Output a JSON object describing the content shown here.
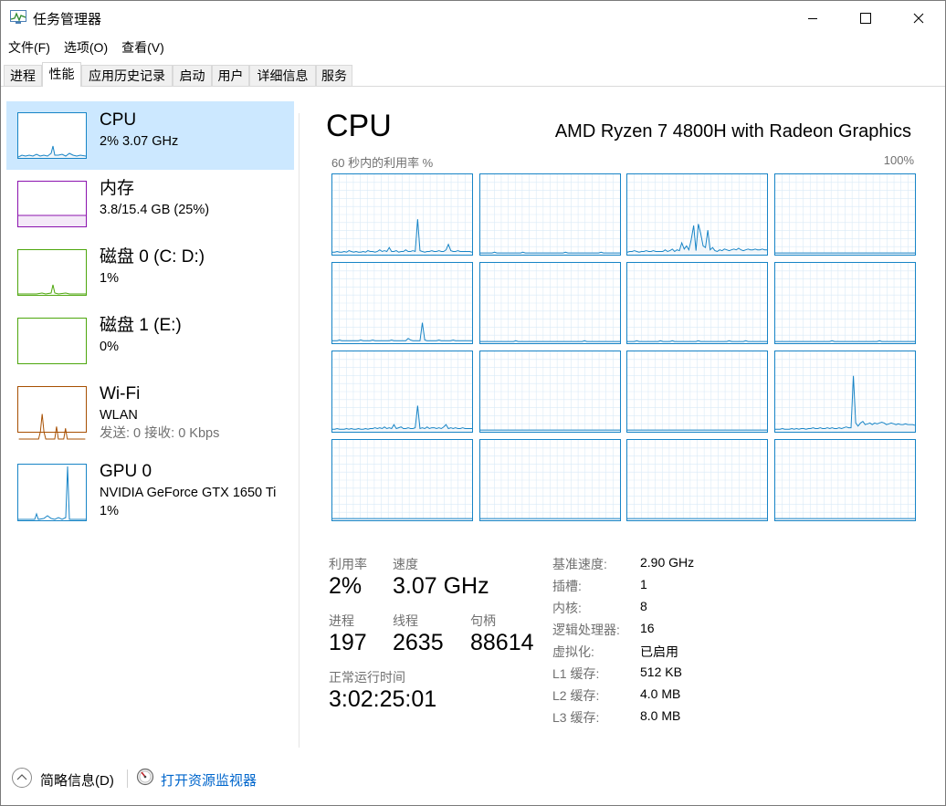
{
  "title": "任务管理器",
  "menu": [
    "文件(F)",
    "选项(O)",
    "查看(V)"
  ],
  "tabs": [
    "进程",
    "性能",
    "应用历史记录",
    "启动",
    "用户",
    "详细信息",
    "服务"
  ],
  "active_tab": "性能",
  "sidebar": {
    "cpu": {
      "title": "CPU",
      "sub1": "2% 3.07 GHz",
      "color": "#1784c6"
    },
    "memory": {
      "title": "内存",
      "sub1": "3.8/15.4 GB (25%)",
      "color": "#8b12ae"
    },
    "disk0": {
      "title": "磁盘 0 (C: D:)",
      "sub1": "1%",
      "color": "#4da60c"
    },
    "disk1": {
      "title": "磁盘 1 (E:)",
      "sub1": "0%",
      "color": "#4da60c"
    },
    "wifi": {
      "title": "Wi-Fi",
      "sub1": "WLAN",
      "sub2": "发送: 0 接收: 0 Kbps",
      "color": "#a74f01"
    },
    "gpu": {
      "title": "GPU 0",
      "sub1": "NVIDIA GeForce GTX 1650 Ti",
      "sub2": "1%",
      "color": "#1784c6"
    }
  },
  "main": {
    "heading": "CPU",
    "model": "AMD Ryzen 7 4800H with Radeon Graphics",
    "graph_caption": "60 秒内的利用率 %",
    "graph_max": "100%",
    "stats": {
      "utilization_label": "利用率",
      "utilization": "2%",
      "speed_label": "速度",
      "speed": "3.07 GHz",
      "processes_label": "进程",
      "processes": "197",
      "threads_label": "线程",
      "threads": "2635",
      "handles_label": "句柄",
      "handles": "88614",
      "uptime_label": "正常运行时间",
      "uptime": "3:02:25:01"
    },
    "specs": [
      {
        "key": "基准速度:",
        "value": "2.90 GHz"
      },
      {
        "key": "插槽:",
        "value": "1"
      },
      {
        "key": "内核:",
        "value": "8"
      },
      {
        "key": "逻辑处理器:",
        "value": "16"
      },
      {
        "key": "虚拟化:",
        "value": "已启用"
      },
      {
        "key": "L1 缓存:",
        "value": "512 KB"
      },
      {
        "key": "L2 缓存:",
        "value": "4.0 MB"
      },
      {
        "key": "L3 缓存:",
        "value": "8.0 MB"
      }
    ]
  },
  "footer": {
    "fewer_details": "简略信息(D)",
    "open_resmon": "打开资源监视器"
  },
  "colors": {
    "cpu_line": "#1784c6",
    "cpu_fill": "#f1f6fa",
    "grid": "#d9eaf7",
    "selection": "#cce8ff",
    "link": "#0066cc"
  },
  "core_usage": [
    [
      2,
      2,
      3,
      2,
      2,
      3,
      2,
      4,
      3,
      2,
      3,
      2,
      2,
      3,
      2,
      4,
      3,
      3,
      2,
      3,
      5,
      3,
      4,
      3,
      8,
      3,
      3,
      4,
      2,
      3,
      3,
      5,
      3,
      3,
      4,
      3,
      44,
      4,
      3,
      2,
      3,
      3,
      4,
      3,
      3,
      4,
      3,
      3,
      5,
      12,
      4,
      3,
      3,
      4,
      3,
      3,
      3,
      3,
      3,
      2
    ],
    [
      1,
      1,
      1,
      1,
      1,
      1,
      2,
      1,
      1,
      1,
      1,
      1,
      1,
      1,
      1,
      1,
      1,
      1,
      2,
      1,
      1,
      1,
      1,
      1,
      1,
      1,
      1,
      1,
      1,
      1,
      1,
      1,
      1,
      1,
      1,
      1,
      2,
      1,
      1,
      1,
      1,
      1,
      1,
      1,
      1,
      1,
      1,
      1,
      1,
      1,
      1,
      2,
      1,
      1,
      1,
      1,
      1,
      1,
      1,
      1
    ],
    [
      2,
      3,
      3,
      4,
      3,
      2,
      3,
      3,
      4,
      3,
      3,
      4,
      3,
      3,
      3,
      3,
      5,
      3,
      4,
      6,
      3,
      5,
      4,
      14,
      6,
      10,
      5,
      18,
      36,
      4,
      38,
      26,
      10,
      8,
      30,
      5,
      8,
      4,
      3,
      5,
      4,
      6,
      5,
      4,
      5,
      6,
      5,
      7,
      5,
      4,
      5,
      6,
      5,
      5,
      6,
      5,
      5,
      6,
      5,
      5
    ],
    [
      1,
      1,
      1,
      1,
      1,
      1,
      1,
      1,
      1,
      1,
      1,
      1,
      1,
      1,
      1,
      1,
      1,
      1,
      1,
      1,
      1,
      1,
      1,
      1,
      1,
      1,
      1,
      1,
      1,
      1,
      1,
      1,
      1,
      1,
      1,
      1,
      1,
      1,
      1,
      1,
      1,
      1,
      1,
      1,
      1,
      1,
      1,
      1,
      1,
      1,
      1,
      1,
      1,
      1,
      1,
      1,
      1,
      1,
      1,
      1
    ],
    [
      2,
      2,
      2,
      3,
      2,
      2,
      2,
      2,
      2,
      2,
      2,
      2,
      3,
      2,
      2,
      2,
      2,
      3,
      2,
      2,
      2,
      2,
      2,
      2,
      2,
      3,
      2,
      2,
      2,
      2,
      2,
      2,
      5,
      3,
      2,
      2,
      2,
      2,
      25,
      3,
      2,
      2,
      2,
      2,
      2,
      3,
      2,
      2,
      2,
      2,
      2,
      3,
      2,
      2,
      2,
      2,
      2,
      2,
      2,
      2
    ],
    [
      1,
      1,
      1,
      1,
      1,
      1,
      1,
      1,
      1,
      1,
      1,
      1,
      1,
      1,
      1,
      2,
      1,
      1,
      1,
      1,
      1,
      1,
      1,
      1,
      1,
      1,
      1,
      1,
      1,
      1,
      1,
      1,
      1,
      1,
      1,
      1,
      1,
      1,
      1,
      1,
      1,
      1,
      1,
      1,
      2,
      1,
      1,
      1,
      1,
      1,
      1,
      1,
      1,
      1,
      1,
      1,
      1,
      1,
      1,
      1
    ],
    [
      1,
      1,
      1,
      1,
      2,
      1,
      1,
      1,
      1,
      1,
      1,
      1,
      1,
      1,
      2,
      1,
      1,
      1,
      1,
      2,
      1,
      1,
      1,
      1,
      1,
      1,
      1,
      1,
      1,
      1,
      2,
      1,
      1,
      1,
      1,
      1,
      1,
      1,
      1,
      1,
      1,
      1,
      1,
      2,
      1,
      1,
      1,
      1,
      1,
      1,
      2,
      1,
      1,
      1,
      1,
      1,
      1,
      1,
      1,
      1
    ],
    [
      1,
      1,
      1,
      1,
      1,
      1,
      1,
      1,
      1,
      1,
      1,
      1,
      1,
      1,
      1,
      1,
      1,
      1,
      1,
      1,
      1,
      1,
      1,
      1,
      2,
      1,
      1,
      1,
      1,
      1,
      1,
      1,
      1,
      1,
      1,
      1,
      1,
      1,
      1,
      1,
      1,
      1,
      1,
      1,
      2,
      1,
      1,
      1,
      1,
      1,
      1,
      1,
      1,
      1,
      1,
      1,
      1,
      1,
      1,
      1
    ],
    [
      2,
      2,
      3,
      2,
      2,
      2,
      3,
      2,
      3,
      2,
      2,
      3,
      2,
      2,
      3,
      2,
      3,
      3,
      4,
      3,
      4,
      3,
      5,
      3,
      4,
      3,
      8,
      3,
      4,
      5,
      3,
      3,
      4,
      3,
      3,
      4,
      32,
      3,
      4,
      3,
      5,
      3,
      4,
      4,
      3,
      4,
      3,
      5,
      8,
      3,
      4,
      3,
      4,
      3,
      3,
      4,
      3,
      3,
      3,
      3
    ],
    [
      1,
      1,
      1,
      1,
      1,
      1,
      1,
      1,
      1,
      1,
      1,
      1,
      1,
      1,
      1,
      1,
      1,
      1,
      1,
      1,
      1,
      1,
      1,
      1,
      1,
      1,
      1,
      1,
      1,
      1,
      1,
      1,
      1,
      1,
      1,
      1,
      1,
      1,
      1,
      1,
      1,
      1,
      1,
      1,
      1,
      1,
      1,
      1,
      1,
      1,
      1,
      1,
      1,
      1,
      1,
      1,
      1,
      1,
      1,
      1
    ],
    [
      1,
      1,
      1,
      1,
      1,
      1,
      1,
      1,
      1,
      1,
      1,
      1,
      1,
      1,
      1,
      1,
      1,
      1,
      1,
      1,
      1,
      1,
      1,
      1,
      1,
      1,
      1,
      1,
      1,
      1,
      1,
      1,
      1,
      1,
      1,
      1,
      1,
      1,
      1,
      1,
      1,
      1,
      1,
      1,
      1,
      1,
      1,
      1,
      1,
      1,
      1,
      1,
      1,
      1,
      1,
      1,
      1,
      1,
      1,
      1
    ],
    [
      2,
      2,
      2,
      3,
      2,
      2,
      2,
      3,
      2,
      3,
      2,
      3,
      3,
      2,
      3,
      3,
      4,
      3,
      3,
      4,
      3,
      3,
      4,
      3,
      4,
      3,
      3,
      4,
      3,
      4,
      5,
      4,
      4,
      70,
      10,
      6,
      10,
      12,
      8,
      9,
      10,
      8,
      10,
      9,
      10,
      11,
      10,
      8,
      9,
      10,
      9,
      8,
      9,
      8,
      8,
      9,
      8,
      8,
      8,
      7
    ],
    [
      1,
      1,
      1,
      1,
      1,
      1,
      1,
      1,
      1,
      1,
      1,
      1,
      1,
      1,
      1,
      1,
      1,
      1,
      1,
      1,
      1,
      1,
      1,
      1,
      1,
      1,
      1,
      1,
      1,
      1,
      1,
      1,
      1,
      1,
      1,
      1,
      1,
      1,
      1,
      1,
      1,
      1,
      1,
      1,
      1,
      1,
      1,
      1,
      1,
      1,
      1,
      1,
      1,
      1,
      1,
      1,
      1,
      1,
      1,
      1
    ],
    [
      1,
      1,
      1,
      1,
      1,
      1,
      1,
      1,
      1,
      1,
      1,
      1,
      1,
      1,
      1,
      1,
      1,
      1,
      1,
      1,
      1,
      1,
      1,
      1,
      1,
      1,
      1,
      1,
      1,
      1,
      1,
      1,
      1,
      1,
      1,
      1,
      1,
      1,
      1,
      1,
      1,
      1,
      1,
      1,
      1,
      1,
      1,
      1,
      1,
      1,
      1,
      1,
      1,
      1,
      1,
      1,
      1,
      1,
      1,
      1
    ],
    [
      1,
      1,
      1,
      1,
      1,
      1,
      1,
      1,
      1,
      1,
      1,
      1,
      1,
      1,
      1,
      1,
      1,
      1,
      1,
      1,
      1,
      1,
      1,
      1,
      1,
      1,
      1,
      1,
      1,
      1,
      1,
      1,
      1,
      1,
      1,
      1,
      1,
      1,
      1,
      1,
      1,
      1,
      1,
      1,
      1,
      1,
      1,
      1,
      1,
      1,
      1,
      1,
      1,
      1,
      1,
      1,
      1,
      1,
      1,
      1
    ],
    [
      1,
      1,
      1,
      1,
      1,
      1,
      1,
      1,
      1,
      1,
      1,
      1,
      1,
      1,
      1,
      1,
      1,
      1,
      1,
      1,
      1,
      1,
      1,
      1,
      1,
      1,
      1,
      1,
      1,
      1,
      1,
      1,
      1,
      1,
      1,
      1,
      1,
      1,
      1,
      1,
      1,
      1,
      1,
      1,
      1,
      1,
      1,
      1,
      1,
      1,
      1,
      1,
      1,
      1,
      1,
      1,
      1,
      1,
      1,
      1
    ]
  ]
}
